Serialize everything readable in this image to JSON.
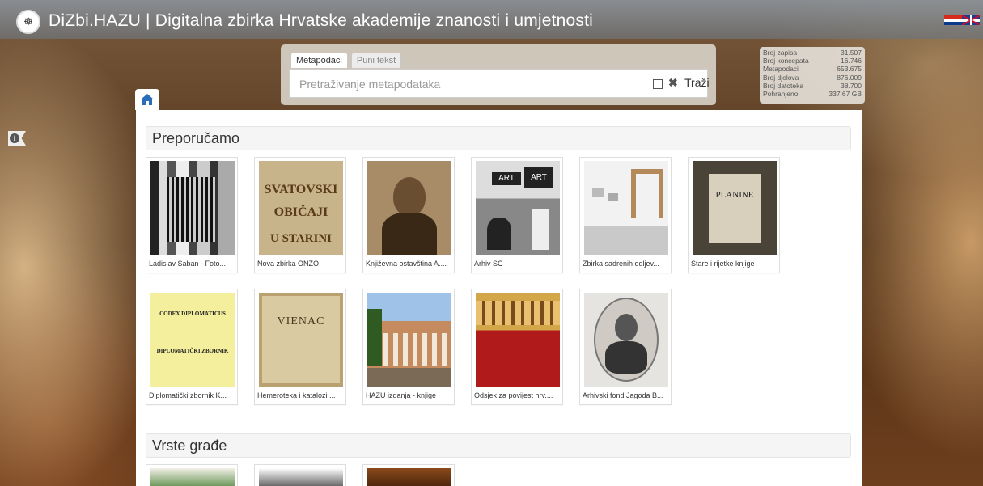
{
  "header": {
    "site_title": "DiZbi.HAZU | Digitalna zbirka Hrvatske akademije znanosti i umjetnosti",
    "logo_icon": "academy-seal-icon",
    "languages": [
      "hr-flag-icon",
      "uk-flag-icon"
    ]
  },
  "search": {
    "tabs": [
      {
        "label": "Metapodaci",
        "active": true
      },
      {
        "label": "Puni tekst",
        "active": false
      }
    ],
    "placeholder": "Pretraživanje metapodataka",
    "button_label": "Traži"
  },
  "stats": [
    {
      "label": "Broj zapisa",
      "value": "31.507"
    },
    {
      "label": "Broj koncepata",
      "value": "16.746"
    },
    {
      "label": "Metapodaci",
      "value": "653.675"
    },
    {
      "label": "Broj djelova",
      "value": "876.009"
    },
    {
      "label": "Broj datoteka",
      "value": "38.700"
    },
    {
      "label": "Pohranjeno",
      "value": "337.67 GB"
    }
  ],
  "sections": {
    "recommended_title": "Preporučamo",
    "types_title": "Vrste građe"
  },
  "recommended": [
    {
      "caption": "Ladislav Šaban - Foto..."
    },
    {
      "caption": "Nova zbirka ONŽO"
    },
    {
      "caption": "Književna ostavština A...."
    },
    {
      "caption": "Arhiv SC"
    },
    {
      "caption": "Zbirka sadrenih odljev..."
    },
    {
      "caption": "Stare i rijetke knjige"
    },
    {
      "caption": "Diplomatički zbornik K..."
    },
    {
      "caption": "Hemeroteka i katalozi ..."
    },
    {
      "caption": "HAZU izdanja - knjige"
    },
    {
      "caption": "Odsjek za povijest hrv...."
    },
    {
      "caption": "Arhivski fond Jagoda B..."
    }
  ],
  "thumb_text": {
    "svatovski": [
      "SVATOVSKI",
      "OBIČAJI",
      "U STARINI"
    ],
    "art": "ART",
    "planine": "PLANINE",
    "codex": [
      "CODEX DIPLOMATICUS",
      "DIPLOMATIČKI ZBORNIK"
    ],
    "vienac": "VIENAC"
  },
  "colors": {
    "accent": "#2a6ebb",
    "section_bg": "#f5f5f5"
  }
}
